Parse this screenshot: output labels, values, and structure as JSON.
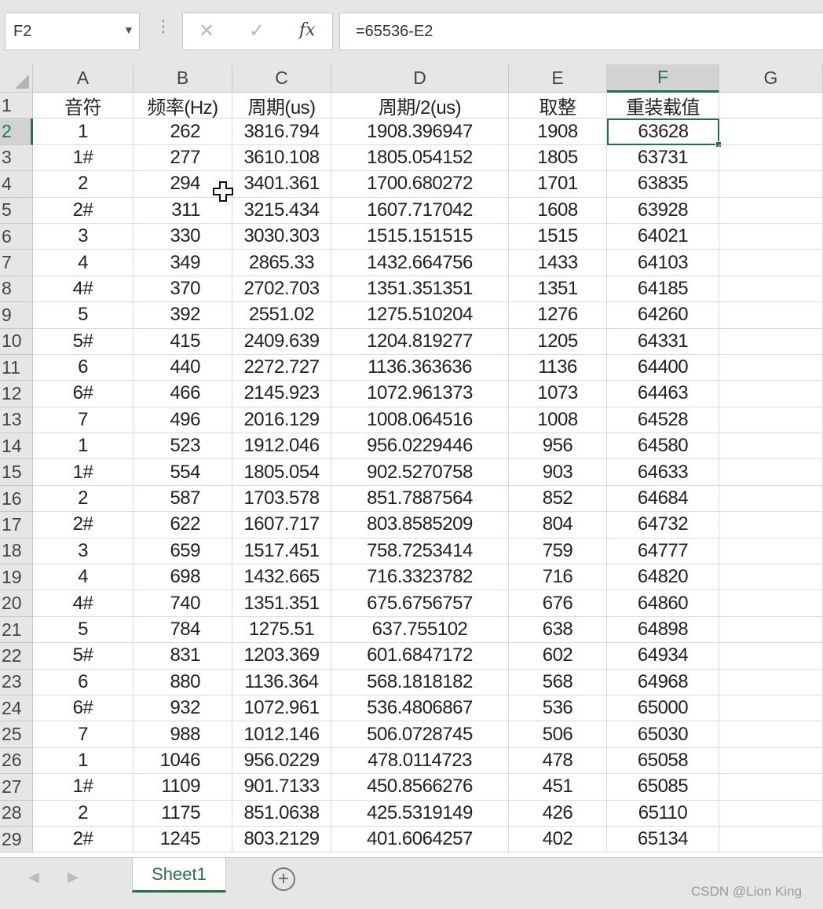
{
  "formula_bar": {
    "name_box": "F2",
    "name_box_dropdown_icon": "chevron-down-icon",
    "dots": "⋮",
    "cancel_glyph": "✕",
    "enter_glyph": "✓",
    "function_glyph": "fx",
    "formula": "=65536-E2"
  },
  "columns": [
    "A",
    "B",
    "C",
    "D",
    "E",
    "F",
    "G"
  ],
  "active_column": "F",
  "active_row": "2",
  "rows": [
    {
      "n": "1",
      "cells": [
        "音符",
        "频率(Hz)",
        "周期(us)",
        "周期/2(us)",
        "取整",
        "重装载值"
      ]
    },
    {
      "n": "2",
      "cells": [
        "1",
        "262",
        "3816.794",
        "1908.396947",
        "1908",
        "63628"
      ]
    },
    {
      "n": "3",
      "cells": [
        "1#",
        "277",
        "3610.108",
        "1805.054152",
        "1805",
        "63731"
      ]
    },
    {
      "n": "4",
      "cells": [
        "2",
        "294",
        "3401.361",
        "1700.680272",
        "1701",
        "63835"
      ]
    },
    {
      "n": "5",
      "cells": [
        "2#",
        "311",
        "3215.434",
        "1607.717042",
        "1608",
        "63928"
      ]
    },
    {
      "n": "6",
      "cells": [
        "3",
        "330",
        "3030.303",
        "1515.151515",
        "1515",
        "64021"
      ]
    },
    {
      "n": "7",
      "cells": [
        "4",
        "349",
        "2865.33",
        "1432.664756",
        "1433",
        "64103"
      ]
    },
    {
      "n": "8",
      "cells": [
        "4#",
        "370",
        "2702.703",
        "1351.351351",
        "1351",
        "64185"
      ]
    },
    {
      "n": "9",
      "cells": [
        "5",
        "392",
        "2551.02",
        "1275.510204",
        "1276",
        "64260"
      ]
    },
    {
      "n": "10",
      "cells": [
        "5#",
        "415",
        "2409.639",
        "1204.819277",
        "1205",
        "64331"
      ]
    },
    {
      "n": "11",
      "cells": [
        "6",
        "440",
        "2272.727",
        "1136.363636",
        "1136",
        "64400"
      ]
    },
    {
      "n": "12",
      "cells": [
        "6#",
        "466",
        "2145.923",
        "1072.961373",
        "1073",
        "64463"
      ]
    },
    {
      "n": "13",
      "cells": [
        "7",
        "496",
        "2016.129",
        "1008.064516",
        "1008",
        "64528"
      ]
    },
    {
      "n": "14",
      "cells": [
        "1",
        "523",
        "1912.046",
        "956.0229446",
        "956",
        "64580"
      ]
    },
    {
      "n": "15",
      "cells": [
        "1#",
        "554",
        "1805.054",
        "902.5270758",
        "903",
        "64633"
      ]
    },
    {
      "n": "16",
      "cells": [
        "2",
        "587",
        "1703.578",
        "851.7887564",
        "852",
        "64684"
      ]
    },
    {
      "n": "17",
      "cells": [
        "2#",
        "622",
        "1607.717",
        "803.8585209",
        "804",
        "64732"
      ]
    },
    {
      "n": "18",
      "cells": [
        "3",
        "659",
        "1517.451",
        "758.7253414",
        "759",
        "64777"
      ]
    },
    {
      "n": "19",
      "cells": [
        "4",
        "698",
        "1432.665",
        "716.3323782",
        "716",
        "64820"
      ]
    },
    {
      "n": "20",
      "cells": [
        "4#",
        "740",
        "1351.351",
        "675.6756757",
        "676",
        "64860"
      ]
    },
    {
      "n": "21",
      "cells": [
        "5",
        "784",
        "1275.51",
        "637.755102",
        "638",
        "64898"
      ]
    },
    {
      "n": "22",
      "cells": [
        "5#",
        "831",
        "1203.369",
        "601.6847172",
        "602",
        "64934"
      ]
    },
    {
      "n": "23",
      "cells": [
        "6",
        "880",
        "1136.364",
        "568.1818182",
        "568",
        "64968"
      ]
    },
    {
      "n": "24",
      "cells": [
        "6#",
        "932",
        "1072.961",
        "536.4806867",
        "536",
        "65000"
      ]
    },
    {
      "n": "25",
      "cells": [
        "7",
        "988",
        "1012.146",
        "506.0728745",
        "506",
        "65030"
      ]
    },
    {
      "n": "26",
      "cells": [
        "1",
        "1046",
        "956.0229",
        "478.0114723",
        "478",
        "65058"
      ]
    },
    {
      "n": "27",
      "cells": [
        "1#",
        "1109",
        "901.7133",
        "450.8566276",
        "451",
        "65085"
      ]
    },
    {
      "n": "28",
      "cells": [
        "2",
        "1175",
        "851.0638",
        "425.5319149",
        "426",
        "65110"
      ]
    },
    {
      "n": "29",
      "cells": [
        "2#",
        "1245",
        "803.2129",
        "401.6064257",
        "402",
        "65134"
      ]
    }
  ],
  "sheet_tabs": [
    "Sheet1"
  ],
  "tab_nav": {
    "prev": "◀",
    "next": "▶",
    "add": "+"
  },
  "watermark": "CSDN @Lion King",
  "colors": {
    "accent": "#217346",
    "header_bg": "#e6e6e6",
    "gridline": "#dadada"
  }
}
